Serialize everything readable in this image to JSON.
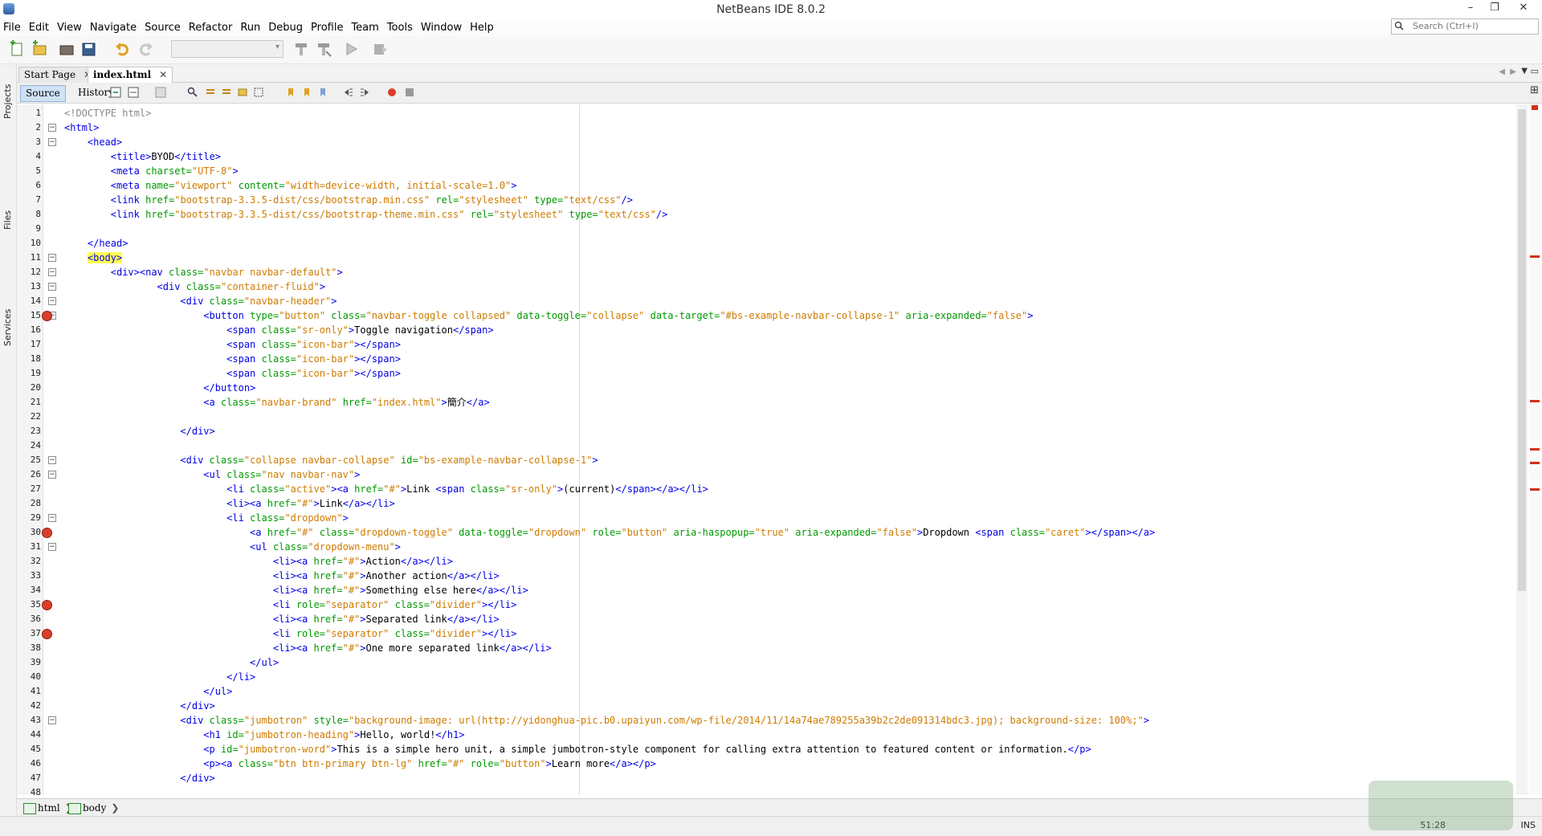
{
  "window": {
    "title": "NetBeans IDE 8.0.2",
    "minimize": "–",
    "restore": "❐",
    "close": "✕"
  },
  "menu": [
    "File",
    "Edit",
    "View",
    "Navigate",
    "Source",
    "Refactor",
    "Run",
    "Debug",
    "Profile",
    "Team",
    "Tools",
    "Window",
    "Help"
  ],
  "search": {
    "placeholder": "Search (Ctrl+I)"
  },
  "side_tabs": [
    "Projects",
    "Files",
    "Services"
  ],
  "tabs": [
    {
      "label": "Start Page",
      "close": "✕"
    },
    {
      "label": "index.html",
      "close": "✕"
    }
  ],
  "editor_toolbar": {
    "source": "Source",
    "history": "History"
  },
  "code": {
    "lines": [
      "1",
      "2",
      "3",
      "4",
      "5",
      "6",
      "7",
      "8",
      "9",
      "10",
      "11",
      "12",
      "13",
      "14",
      "15",
      "16",
      "17",
      "18",
      "19",
      "20",
      "21",
      "22",
      "23",
      "24",
      "25",
      "26",
      "27",
      "28",
      "29",
      "30",
      "31",
      "32",
      "33",
      "34",
      "35",
      "36",
      "37",
      "38",
      "39",
      "40",
      "41",
      "42",
      "43",
      "44",
      "45",
      "46",
      "47",
      "48"
    ],
    "l1": "<!DOCTYPE html>",
    "l2": "<html>",
    "l3": "<head>",
    "l4a": "<title>",
    "l4b": "BYOD",
    "l4c": "</title>",
    "l5a": "<meta ",
    "l5b": "charset=",
    "l5c": "\"UTF-8\"",
    "l5d": ">",
    "l6a": "<meta ",
    "l6b": "name=",
    "l6c": "\"viewport\" ",
    "l6d": "content=",
    "l6e": "\"width=device-width, initial-scale=1.0\"",
    "l6f": ">",
    "l7a": "<link ",
    "l7b": "href=",
    "l7c": "\"bootstrap-3.3.5-dist/css/bootstrap.min.css\" ",
    "l7d": "rel=",
    "l7e": "\"stylesheet\" ",
    "l7f": "type=",
    "l7g": "\"text/css\"",
    "l7h": "/>",
    "l8a": "<link ",
    "l8b": "href=",
    "l8c": "\"bootstrap-3.3.5-dist/css/bootstrap-theme.min.css\" ",
    "l8d": "rel=",
    "l8e": "\"stylesheet\" ",
    "l8f": "type=",
    "l8g": "\"text/css\"",
    "l8h": "/>",
    "l10": "</head>",
    "l11": "<body>",
    "l12a": "<div><nav ",
    "l12b": "class=",
    "l12c": "\"navbar navbar-default\"",
    "l12d": ">",
    "l13a": "<div ",
    "l13b": "class=",
    "l13c": "\"container-fluid\"",
    "l13d": ">",
    "l14a": "<div ",
    "l14b": "class=",
    "l14c": "\"navbar-header\"",
    "l14d": ">",
    "l15a": "<button ",
    "l15b": "type=",
    "l15c": "\"button\" ",
    "l15d": "class=",
    "l15e": "\"navbar-toggle collapsed\" ",
    "l15f": "data-toggle=",
    "l15g": "\"collapse\" ",
    "l15h": "data-target=",
    "l15i": "\"#bs-example-navbar-collapse-1\" ",
    "l15j": "aria-expanded=",
    "l15k": "\"false\"",
    "l15l": ">",
    "l16a": "<span ",
    "l16b": "class=",
    "l16c": "\"sr-only\"",
    "l16d": ">",
    "l16e": "Toggle navigation",
    "l16f": "</span>",
    "l17a": "<span ",
    "l17b": "class=",
    "l17c": "\"icon-bar\"",
    "l17d": "></span>",
    "l18a": "<span ",
    "l18b": "class=",
    "l18c": "\"icon-bar\"",
    "l18d": "></span>",
    "l19a": "<span ",
    "l19b": "class=",
    "l19c": "\"icon-bar\"",
    "l19d": "></span>",
    "l20": "</button>",
    "l21a": "<a ",
    "l21b": "class=",
    "l21c": "\"navbar-brand\" ",
    "l21d": "href=",
    "l21e": "\"index.html\"",
    "l21f": ">",
    "l21g": "簡介",
    "l21h": "</a>",
    "l23": "</div>",
    "l25a": "<div ",
    "l25b": "class=",
    "l25c": "\"collapse navbar-collapse\" ",
    "l25d": "id=",
    "l25e": "\"bs-example-navbar-collapse-1\"",
    "l25f": ">",
    "l26a": "<ul ",
    "l26b": "class=",
    "l26c": "\"nav navbar-nav\"",
    "l26d": ">",
    "l27a": "<li ",
    "l27b": "class=",
    "l27c": "\"active\"",
    "l27d": "><a ",
    "l27e": "href=",
    "l27f": "\"#\"",
    "l27g": ">",
    "l27h": "Link ",
    "l27i": "<span ",
    "l27j": "class=",
    "l27k": "\"sr-only\"",
    "l27l": ">",
    "l27m": "(current)",
    "l27n": "</span></a></li>",
    "l28a": "<li><a ",
    "l28b": "href=",
    "l28c": "\"#\"",
    "l28d": ">",
    "l28e": "Link",
    "l28f": "</a></li>",
    "l29a": "<li ",
    "l29b": "class=",
    "l29c": "\"dropdown\"",
    "l29d": ">",
    "l30a": "<a ",
    "l30b": "href=",
    "l30c": "\"#\" ",
    "l30d": "class=",
    "l30e": "\"dropdown-toggle\" ",
    "l30f": "data-toggle=",
    "l30g": "\"dropdown\" ",
    "l30h": "role=",
    "l30i": "\"button\" ",
    "l30j": "aria-haspopup=",
    "l30k": "\"true\" ",
    "l30l": "aria-expanded=",
    "l30m": "\"false\"",
    "l30n": ">",
    "l30o": "Dropdown ",
    "l30p": "<span ",
    "l30q": "class=",
    "l30r": "\"caret\"",
    "l30s": "></span></a>",
    "l31a": "<ul ",
    "l31b": "class=",
    "l31c": "\"dropdown-menu\"",
    "l31d": ">",
    "l32a": "<li><a ",
    "l32b": "href=",
    "l32c": "\"#\"",
    "l32d": ">",
    "l32e": "Action",
    "l32f": "</a></li>",
    "l33a": "<li><a ",
    "l33b": "href=",
    "l33c": "\"#\"",
    "l33d": ">",
    "l33e": "Another action",
    "l33f": "</a></li>",
    "l34a": "<li><a ",
    "l34b": "href=",
    "l34c": "\"#\"",
    "l34d": ">",
    "l34e": "Something else here",
    "l34f": "</a></li>",
    "l35a": "<li ",
    "l35b": "role=",
    "l35c": "\"separator\" ",
    "l35d": "class=",
    "l35e": "\"divider\"",
    "l35f": "></li>",
    "l36a": "<li><a ",
    "l36b": "href=",
    "l36c": "\"#\"",
    "l36d": ">",
    "l36e": "Separated link",
    "l36f": "</a></li>",
    "l37a": "<li ",
    "l37b": "role=",
    "l37c": "\"separator\" ",
    "l37d": "class=",
    "l37e": "\"divider\"",
    "l37f": "></li>",
    "l38a": "<li><a ",
    "l38b": "href=",
    "l38c": "\"#\"",
    "l38d": ">",
    "l38e": "One more separated link",
    "l38f": "</a></li>",
    "l39": "</ul>",
    "l40": "</li>",
    "l41": "</ul>",
    "l42": "</div>",
    "l43a": "<div ",
    "l43b": "class=",
    "l43c": "\"jumbotron\" ",
    "l43d": "style=",
    "l43e": "\"background-image: url(http://yidonghua-pic.b0.upaiyun.com/wp-file/2014/11/14a74ae789255a39b2c2de091314bdc3.jpg); background-size: 100%;\"",
    "l43f": ">",
    "l44a": "<h1 ",
    "l44b": "id=",
    "l44c": "\"jumbotron-heading\"",
    "l44d": ">",
    "l44e": "Hello, world!",
    "l44f": "</h1>",
    "l45a": "<p ",
    "l45b": "id=",
    "l45c": "\"jumbotron-word\"",
    "l45d": ">",
    "l45e": "This is a simple hero unit, a simple jumbotron-style component for calling extra attention to featured content or information.",
    "l45f": "</p>",
    "l46a": "<p><a ",
    "l46b": "class=",
    "l46c": "\"btn btn-primary btn-lg\" ",
    "l46d": "href=",
    "l46e": "\"#\" ",
    "l46f": "role=",
    "l46g": "\"button\"",
    "l46h": ">",
    "l46i": "Learn more",
    "l46j": "</a></p>",
    "l47": "</div>"
  },
  "breadcrumb": [
    "html",
    "body"
  ],
  "status": {
    "position": "51:28",
    "mode": "INS"
  },
  "colors": {
    "tag": "#0000e6",
    "attr_name": "#009900",
    "attr_value": "#ce7b00",
    "comment": "#888888",
    "highlight": "#ffff55",
    "error": "#d0311a"
  }
}
